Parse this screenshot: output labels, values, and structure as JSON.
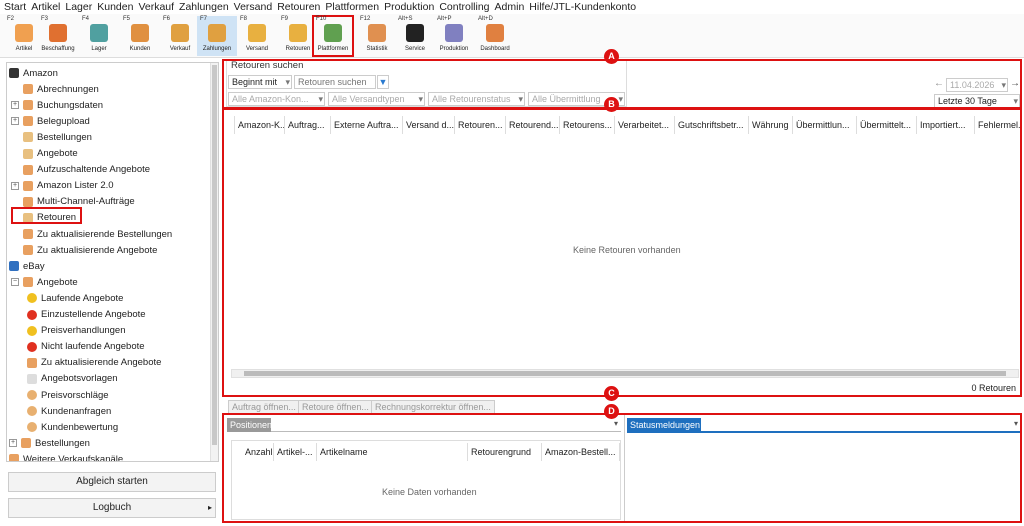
{
  "menu": [
    "Start",
    "Artikel",
    "Lager",
    "Kunden",
    "Verkauf",
    "Zahlungen",
    "Versand",
    "Retouren",
    "Plattformen",
    "Produktion",
    "Controlling",
    "Admin",
    "Hilfe/JTL-Kundenkonto"
  ],
  "toolbar": [
    {
      "key": "F2",
      "label": "Artikel",
      "icon": "shirt-icon",
      "color": "#f0a050"
    },
    {
      "key": "F3",
      "label": "Beschaffung",
      "icon": "truck-icon",
      "color": "#e07030"
    },
    {
      "key": "F4",
      "label": "Lager",
      "icon": "warehouse-icon",
      "color": "#50a0a0"
    },
    {
      "key": "F5",
      "label": "Kunden",
      "icon": "person-icon",
      "color": "#e09040"
    },
    {
      "key": "F6",
      "label": "Verkauf",
      "icon": "invoice-icon",
      "color": "#e0a040"
    },
    {
      "key": "F7",
      "label": "Zahlungen",
      "icon": "coin-icon",
      "color": "#e0a040"
    },
    {
      "key": "F8",
      "label": "Versand",
      "icon": "package-icon",
      "color": "#e8b040"
    },
    {
      "key": "F9",
      "label": "Retouren",
      "icon": "return-icon",
      "color": "#e8b040"
    },
    {
      "key": "F10",
      "label": "Plattformen",
      "icon": "platform-icon",
      "color": "#60a050"
    },
    {
      "key": "F12",
      "label": "Statistik",
      "icon": "statistics-icon",
      "color": "#e09050"
    },
    {
      "key": "Alt+S",
      "label": "Service",
      "icon": "service-icon",
      "color": "#222222"
    },
    {
      "key": "Alt+P",
      "label": "Produktion",
      "icon": "factory-icon",
      "color": "#8080c0"
    },
    {
      "key": "Alt+D",
      "label": "Dashboard",
      "icon": "dashboard-icon",
      "color": "#e08040"
    }
  ],
  "tree": [
    {
      "label": "Amazon",
      "level": 0,
      "exp": "",
      "icon": "amazon-logo-icon",
      "color": "#333"
    },
    {
      "label": "Abrechnungen",
      "level": 1,
      "exp": "",
      "icon": "document-icon",
      "color": "#e8a060"
    },
    {
      "label": "Buchungsdaten",
      "level": 1,
      "exp": "+",
      "icon": "document-icon",
      "color": "#e8a060"
    },
    {
      "label": "Belegupload",
      "level": 1,
      "exp": "+",
      "icon": "document-icon",
      "color": "#e8a060"
    },
    {
      "label": "Bestellungen",
      "level": 1,
      "exp": "",
      "icon": "document-icon",
      "color": "#e8c080"
    },
    {
      "label": "Angebote",
      "level": 1,
      "exp": "",
      "icon": "document-icon",
      "color": "#e8c080"
    },
    {
      "label": "Aufzuschaltende Angebote",
      "level": 1,
      "exp": "",
      "icon": "document-icon",
      "color": "#e8a060"
    },
    {
      "label": "Amazon Lister 2.0",
      "level": 1,
      "exp": "+",
      "icon": "lister-icon",
      "color": "#e8a060"
    },
    {
      "label": "Multi-Channel-Aufträge",
      "level": 1,
      "exp": "",
      "icon": "document-icon",
      "color": "#e8a060"
    },
    {
      "label": "Retouren",
      "level": 1,
      "exp": "",
      "icon": "return-icon",
      "color": "#e8c080"
    },
    {
      "label": "Zu aktualisierende Bestellungen",
      "level": 1,
      "exp": "",
      "icon": "refresh-icon",
      "color": "#e8a060"
    },
    {
      "label": "Zu aktualisierende Angebote",
      "level": 1,
      "exp": "",
      "icon": "refresh-icon",
      "color": "#e8a060"
    },
    {
      "label": "eBay",
      "level": 0,
      "exp": "",
      "icon": "ebay-logo-icon",
      "color": "#3070c0"
    },
    {
      "label": "Angebote",
      "level": 1,
      "exp": "-",
      "icon": "document-icon",
      "color": "#e8a060"
    },
    {
      "label": "Laufende Angebote",
      "level": 2,
      "exp": "",
      "icon": "running-icon",
      "color": "#f0c020"
    },
    {
      "label": "Einzustellende Angebote",
      "level": 2,
      "exp": "",
      "icon": "circle-icon",
      "color": "#e03020"
    },
    {
      "label": "Preisverhandlungen",
      "level": 2,
      "exp": "",
      "icon": "running-icon",
      "color": "#f0c020"
    },
    {
      "label": "Nicht laufende Angebote",
      "level": 2,
      "exp": "",
      "icon": "cross-icon",
      "color": "#e03020"
    },
    {
      "label": "Zu aktualisierende Angebote",
      "level": 2,
      "exp": "",
      "icon": "refresh-icon",
      "color": "#e8a060"
    },
    {
      "label": "Angebotsvorlagen",
      "level": 2,
      "exp": "",
      "icon": "template-icon",
      "color": "#ddd"
    },
    {
      "label": "Preisvorschläge",
      "level": 2,
      "exp": "",
      "icon": "offer-icon",
      "color": "#e8b070"
    },
    {
      "label": "Kundenanfragen",
      "level": 2,
      "exp": "",
      "icon": "question-icon",
      "color": "#e8b070"
    },
    {
      "label": "Kundenbewertung",
      "level": 2,
      "exp": "",
      "icon": "rating-icon",
      "color": "#e8b070"
    },
    {
      "label": "Bestellungen",
      "level": 0,
      "exp": "+",
      "icon": "document-icon",
      "color": "#e8a060"
    },
    {
      "label": "Weitere Verkaufskanäle",
      "level": 0,
      "exp": "",
      "icon": "channel-icon",
      "color": "#e8a060"
    }
  ],
  "left_buttons": {
    "sync": "Abgleich starten",
    "log": "Logbuch"
  },
  "badges": [
    "A",
    "B",
    "C",
    "D"
  ],
  "search": {
    "title": "Retouren suchen",
    "mode": "Beginnt mit",
    "placeholder": "Retouren suchen",
    "filters": [
      "Alle Amazon-Kon...",
      "Alle Versandtypen",
      "Alle Retourenstatus",
      "Alle Übermittlung"
    ],
    "date": "11.04.2026",
    "range": "Letzte 30 Tage"
  },
  "grid": {
    "columns": [
      "Amazon-K...",
      "Auftrag...",
      "Externe Auftra...",
      "Versand d...",
      "Retouren...",
      "Retourend...",
      "Retourens...",
      "Verarbeitet...",
      "Gutschriftsbetr...",
      "Währung",
      "Übermittlun...",
      "Übermittelt...",
      "Importiert...",
      "Fehlermel..."
    ],
    "empty": "Keine Retouren vorhanden",
    "count": "0 Retouren"
  },
  "actions": [
    "Auftrag öffnen...",
    "Retoure öffnen...",
    "Rechnungskorrektur öffnen..."
  ],
  "positions": {
    "tab": "Positionen",
    "columns": [
      "Anzahl",
      "Artikel-...",
      "Artikelname",
      "Retourengrund",
      "Amazon-Bestell..."
    ],
    "empty": "Keine Daten vorhanden"
  },
  "status": {
    "tab": "Statusmeldungen"
  }
}
